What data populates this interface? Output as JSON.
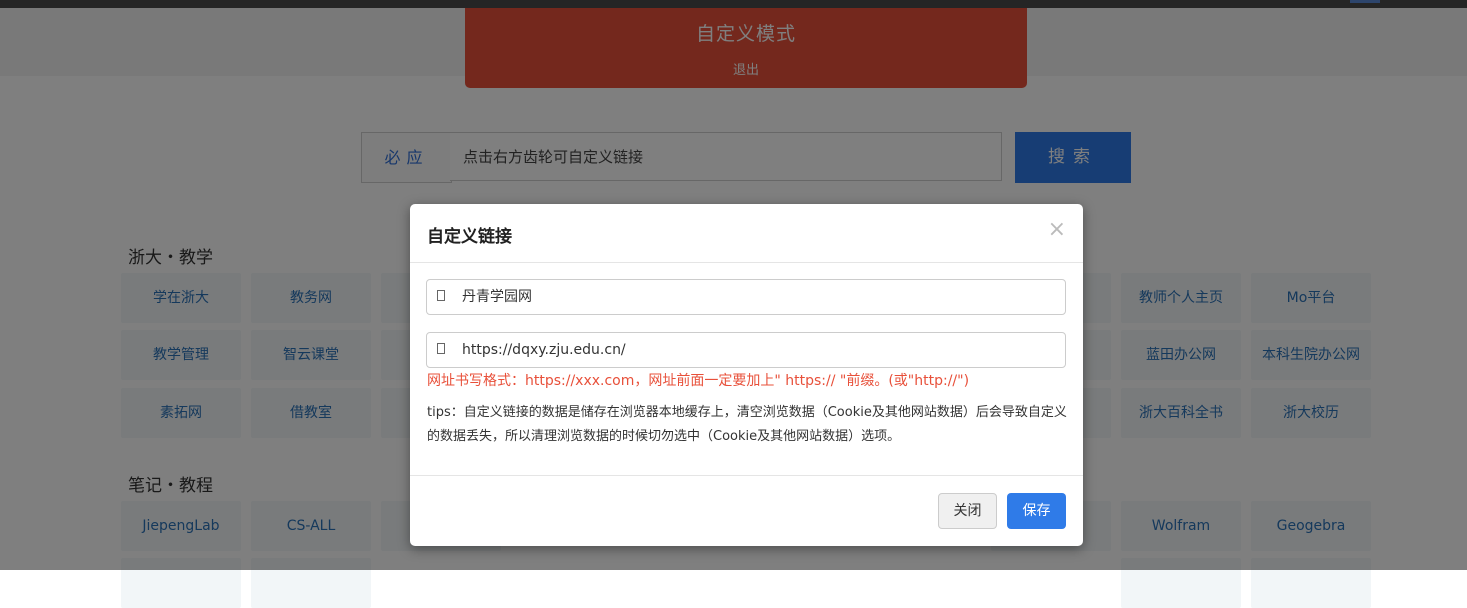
{
  "banner": {
    "title": "自定义模式",
    "exit": "退出"
  },
  "search": {
    "engine": "必应",
    "placeholder": "点击右方齿轮可自定义链接",
    "button": "搜索"
  },
  "sections": {
    "teaching": {
      "title": "浙大・教学",
      "tiles": [
        "学在浙大",
        "教务网",
        "教学管理",
        "智云课堂",
        "素拓网",
        "借教室"
      ]
    },
    "right_top": {
      "tiles": [
        "教师个人主页",
        "Mo平台",
        "蓝田办公网",
        "本科生院办公网",
        "浙大百科全书",
        "浙大校历"
      ]
    },
    "notes": {
      "title": "笔记・教程",
      "tiles": [
        "JiepengLab",
        "CS-ALL"
      ]
    },
    "right_bottom": {
      "tiles": [
        "Wolfram",
        "Geogebra"
      ]
    }
  },
  "modal": {
    "title": "自定义链接",
    "close_symbol": "×",
    "name_value": "丹青学园网",
    "url_value": "https://dqxy.zju.edu.cn/",
    "format_hint": "网址书写格式：https://xxx.com，网址前面一定要加上\" https:// \"前缀。(或\"http://\")",
    "tips": "tips：自定义链接的数据是储存在浏览器本地缓存上，清空浏览数据（Cookie及其他网站数据）后会导致自定义的数据丢失，所以清理浏览数据的时候切勿选中（Cookie及其他网站数据）选项。",
    "close_button": "关闭",
    "save_button": "保存"
  },
  "icons": {
    "field": "file-icon",
    "close": "close-icon"
  }
}
